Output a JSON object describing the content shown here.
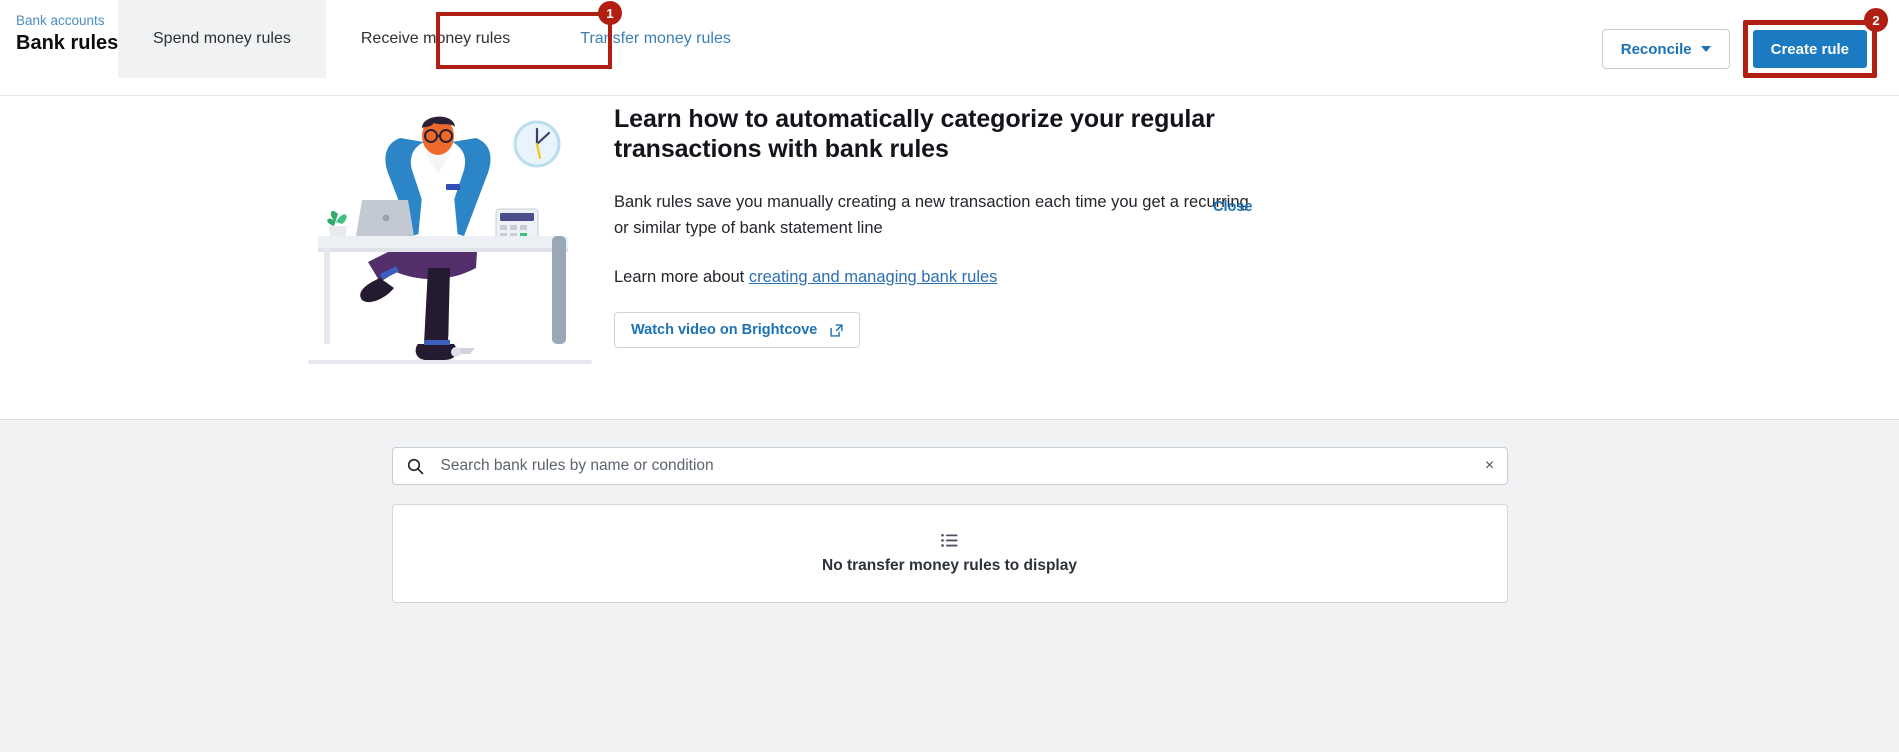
{
  "header": {
    "breadcrumb": "Bank accounts",
    "title": "Bank rules",
    "tabs": [
      {
        "label": "Spend money rules",
        "state": "hovered"
      },
      {
        "label": "Receive money rules",
        "state": "default"
      },
      {
        "label": "Transfer money rules",
        "state": "selected"
      }
    ],
    "reconcile_label": "Reconcile",
    "create_rule_label": "Create rule"
  },
  "annotations": [
    {
      "badge": "1",
      "target": "Transfer money rules tab",
      "color": "#b01f12"
    },
    {
      "badge": "2",
      "target": "Create rule button",
      "color": "#b01f12"
    }
  ],
  "hero": {
    "title": "Learn how to automatically categorize your regular transactions with bank rules",
    "description": "Bank rules save you manually creating a new transaction each time you get a recurring or similar type of bank statement line",
    "learn_more_prefix": "Learn more about ",
    "learn_more_link": "creating and managing bank rules",
    "watch_video_label": "Watch video on Brightcove",
    "external_link_icon": "external-link-icon",
    "close_label": "Close"
  },
  "search": {
    "placeholder": "Search bank rules by name or condition",
    "value": "",
    "icon": "search-icon",
    "clear_icon": "×"
  },
  "empty_state": {
    "icon": "list-icon",
    "message": "No transfer money rules to display"
  },
  "colors": {
    "accent_blue": "#1a7ac2",
    "link_blue": "#2c6fb0",
    "annotation_red": "#b01f12",
    "panel_grey": "#f0f2f4"
  }
}
